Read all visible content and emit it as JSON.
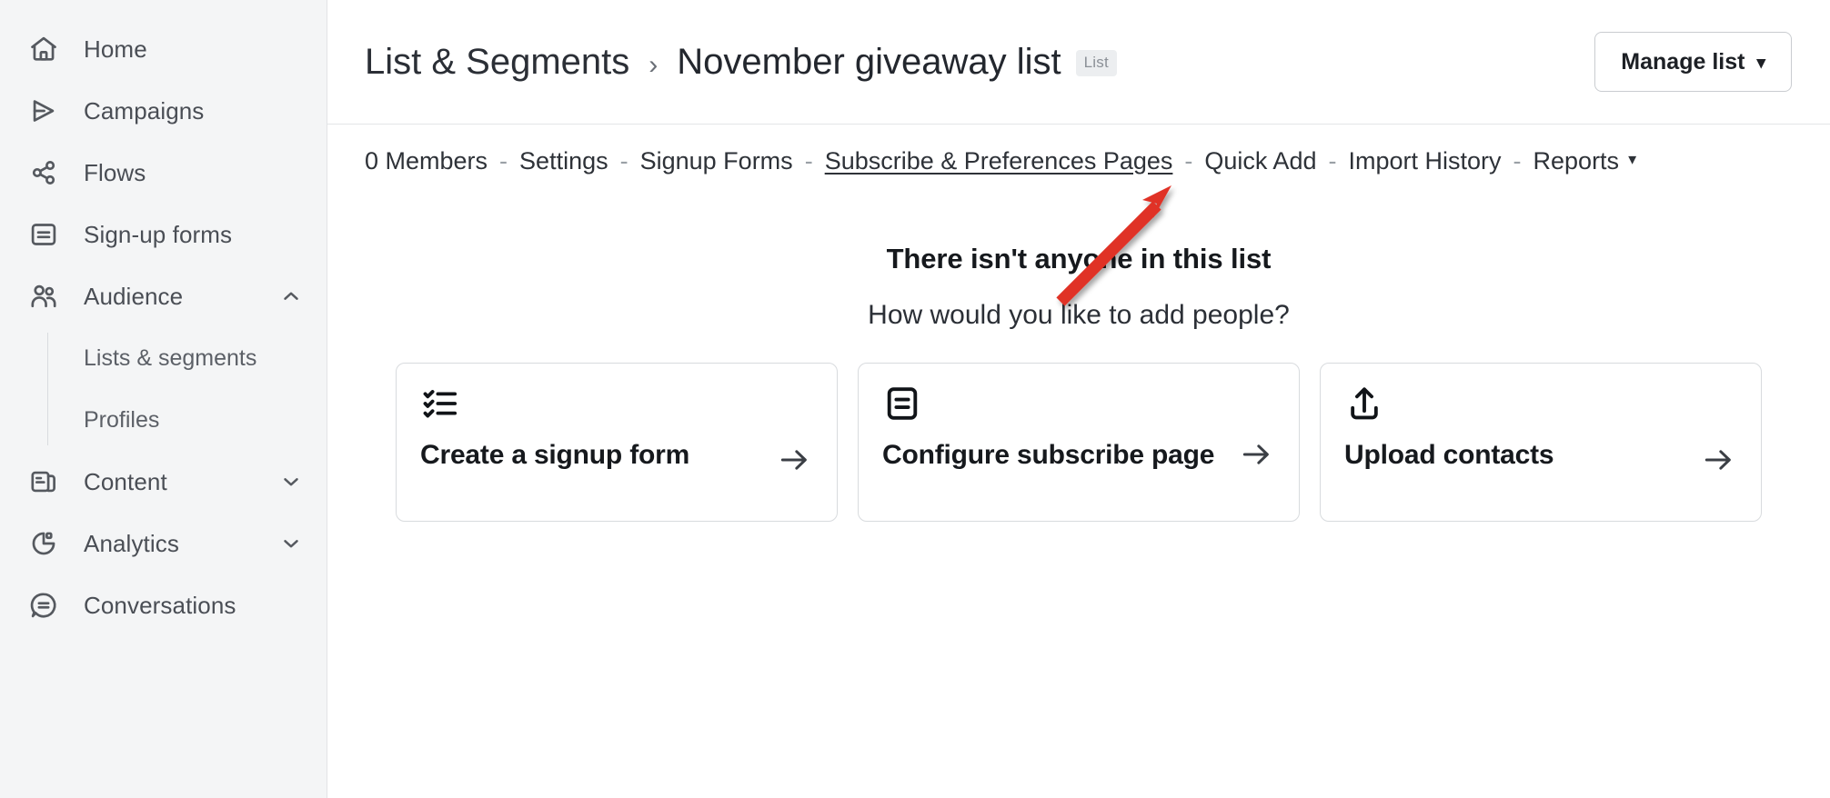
{
  "sidebar": {
    "items": [
      {
        "label": "Home",
        "icon": "home-icon",
        "expandable": false
      },
      {
        "label": "Campaigns",
        "icon": "send-icon",
        "expandable": false
      },
      {
        "label": "Flows",
        "icon": "flows-icon",
        "expandable": false
      },
      {
        "label": "Sign-up forms",
        "icon": "form-icon",
        "expandable": false
      },
      {
        "label": "Audience",
        "icon": "audience-icon",
        "expandable": true,
        "expanded": true,
        "caret": "chevron-up-icon"
      },
      {
        "label": "Content",
        "icon": "content-icon",
        "expandable": true,
        "expanded": false,
        "caret": "chevron-down-icon"
      },
      {
        "label": "Analytics",
        "icon": "analytics-icon",
        "expandable": true,
        "expanded": false,
        "caret": "chevron-down-icon"
      },
      {
        "label": "Conversations",
        "icon": "conversations-icon",
        "expandable": false
      }
    ],
    "audience_children": [
      {
        "label": "Lists & segments"
      },
      {
        "label": "Profiles"
      }
    ]
  },
  "header": {
    "breadcrumb_root": "List & Segments",
    "breadcrumb_separator": "›",
    "breadcrumb_current": "November giveaway list",
    "type_badge": "List",
    "manage_button": "Manage list",
    "manage_caret": "▾"
  },
  "tabbar": {
    "separator": "-",
    "tabs": [
      {
        "label": "0 Members",
        "active": false
      },
      {
        "label": "Settings",
        "active": false
      },
      {
        "label": "Signup Forms",
        "active": false
      },
      {
        "label": "Subscribe & Preferences Pages",
        "active": true
      },
      {
        "label": "Quick Add",
        "active": false
      },
      {
        "label": "Import History",
        "active": false
      },
      {
        "label": "Reports",
        "active": false,
        "caret": "▾"
      }
    ]
  },
  "empty_state": {
    "title": "There isn't anyone in this list",
    "subtitle": "How would you like to add people?",
    "cards": [
      {
        "label": "Create a signup form",
        "icon": "checklist-icon",
        "arrow": "arrow-right-icon",
        "wrap": false
      },
      {
        "label": "Configure subscribe page",
        "icon": "subscribe-page-icon",
        "arrow": "arrow-right-icon",
        "wrap": true
      },
      {
        "label": "Upload contacts",
        "icon": "upload-icon",
        "arrow": "arrow-right-icon",
        "wrap": false
      }
    ]
  },
  "annotation": {
    "kind": "red-arrow",
    "color": "#e03127",
    "points_to": "Subscribe & Preferences Pages"
  },
  "colors": {
    "sidebar_bg": "#f4f5f6",
    "main_bg": "#ffffff",
    "text_primary": "#16191d",
    "text_muted": "#5c6067",
    "border": "#d8dbde",
    "badge_bg": "#eceef0",
    "annotation_red": "#e03127"
  }
}
